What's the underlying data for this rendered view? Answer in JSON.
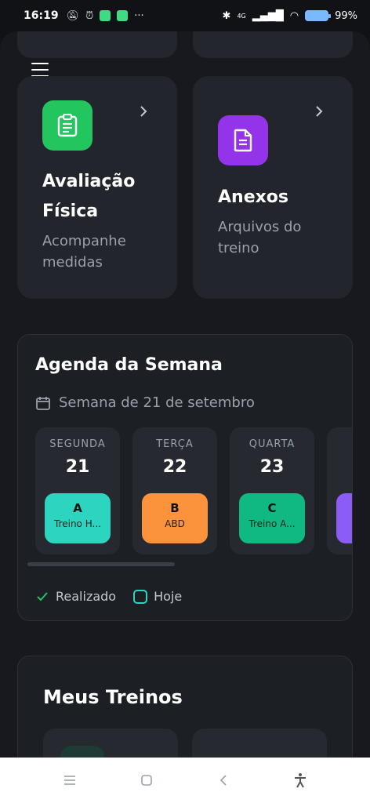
{
  "status_bar": {
    "time": "16:19",
    "battery": "99",
    "battery_unit": "%",
    "network": "4G"
  },
  "tiles": [
    {
      "title_line1": "Avaliação",
      "title_line2": "Física",
      "subtitle_line1": "Acompanhe",
      "subtitle_line2": "medidas",
      "icon": "clipboard-icon",
      "color": "#22c55e"
    },
    {
      "title_line1": "Anexos",
      "subtitle_line1": "Arquivos do",
      "subtitle_line2": "treino",
      "icon": "document-icon",
      "color": "#9333ea"
    }
  ],
  "agenda": {
    "title": "Agenda da Semana",
    "week_label": "Semana de 21 de setembro",
    "days": [
      {
        "name": "SEGUNDA",
        "date": "21",
        "letter": "A",
        "workout": "Treino H...",
        "color": "#2dd4bf"
      },
      {
        "name": "TERÇA",
        "date": "22",
        "letter": "B",
        "workout": "ABD",
        "color": "#fb923c"
      },
      {
        "name": "QUARTA",
        "date": "23",
        "letter": "C",
        "workout": "Treino A...",
        "color": "#10b981"
      }
    ],
    "legend": {
      "done": "Realizado",
      "today": "Hoje"
    },
    "colors": {
      "done_check": "#22c55e",
      "today_box": "#2dd4bf",
      "partial_card": "#8b5cf6"
    }
  },
  "treinos": {
    "title": "Meus Treinos"
  }
}
